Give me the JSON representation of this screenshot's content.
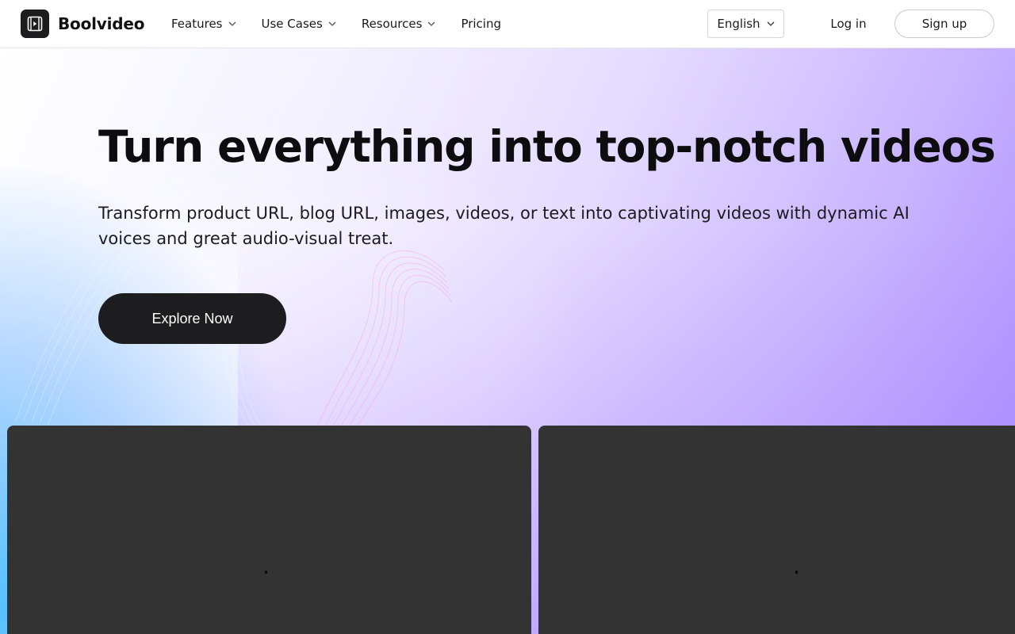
{
  "brand": {
    "name": "Boolvideo",
    "logo_icon": "play-frame-icon"
  },
  "nav": {
    "items": [
      {
        "label": "Features",
        "has_dropdown": true
      },
      {
        "label": "Use Cases",
        "has_dropdown": true
      },
      {
        "label": "Resources",
        "has_dropdown": true
      },
      {
        "label": "Pricing",
        "has_dropdown": false
      }
    ]
  },
  "language": {
    "selected": "English"
  },
  "auth": {
    "login_label": "Log in",
    "signup_label": "Sign up"
  },
  "hero": {
    "title": "Turn everything into top-notch videos",
    "subtitle": "Transform product URL, blog URL, images, videos, or text into captivating videos with dynamic AI voices and great audio-visual treat.",
    "cta_label": "Explore Now"
  },
  "colors": {
    "dark": "#1d1d1f",
    "card": "#333333",
    "accent_purple": "#a786ff",
    "accent_blue": "#4abeff"
  }
}
